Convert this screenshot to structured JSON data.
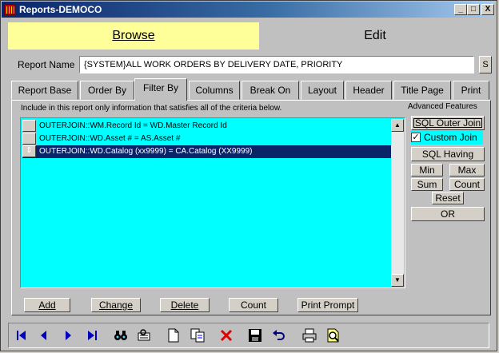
{
  "window": {
    "title": "Reports-DEMOCO"
  },
  "title_buttons": {
    "minimize": "_",
    "maximize": "□",
    "close": "X"
  },
  "modes": {
    "browse": "Browse",
    "edit": "Edit"
  },
  "report_name": {
    "label": "Report Name",
    "value": "{SYSTEM}ALL WORK ORDERS BY DELIVERY DATE, PRIORITY",
    "s_button": "S"
  },
  "tabs": [
    "Report Base",
    "Order By",
    "Filter By",
    "Columns",
    "Break On",
    "Layout",
    "Header",
    "Title Page",
    "Print"
  ],
  "active_tab": "Filter By",
  "filter": {
    "instruction": "Include in this report only information that satisfies all of the criteria below.",
    "rows": [
      "OUTERJOIN::WM.Record Id = WD.Master Record Id",
      "OUTERJOIN::WD.Asset # = AS.Asset #",
      "OUTERJOIN::WD.Catalog (xx9999) = CA.Catalog (XX9999)"
    ],
    "selected_row_marker": "⇕"
  },
  "advanced": {
    "heading": "Advanced Features",
    "sql_outer_join": "SQL Outer Join",
    "custom_join": "Custom Join",
    "custom_join_checked": true,
    "sql_having": "SQL Having",
    "min": "Min",
    "max": "Max",
    "sum": "Sum",
    "count": "Count",
    "reset": "Reset",
    "or": "OR"
  },
  "bottom_buttons": {
    "add": "Add",
    "change": "Change",
    "delete": "Delete",
    "count": "Count",
    "print_prompt": "Print Prompt"
  },
  "toolbar_icons": [
    "first-record-icon",
    "previous-record-icon",
    "next-record-icon",
    "last-record-icon",
    "binoculars-icon",
    "find-record-icon",
    "new-document-icon",
    "copy-icon",
    "delete-x-icon",
    "save-icon",
    "undo-icon",
    "print-icon",
    "print-preview-icon"
  ],
  "colors": {
    "accent_yellow": "#ffff99",
    "list_bg": "#00ffff",
    "selection": "#0a246a",
    "nav_arrow": "#0000c0",
    "delete_red": "#e00000"
  }
}
